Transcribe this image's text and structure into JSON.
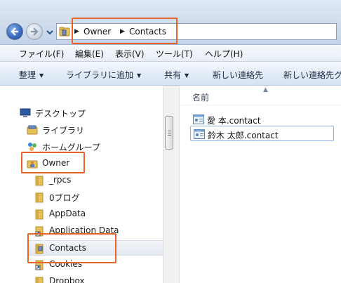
{
  "address": {
    "crumbs": [
      "Owner",
      "Contacts"
    ]
  },
  "menubar": {
    "items": [
      "ファイル(F)",
      "編集(E)",
      "表示(V)",
      "ツール(T)",
      "ヘルプ(H)"
    ]
  },
  "commandbar": {
    "items": [
      "整理",
      "ライブラリに追加",
      "共有",
      "新しい連絡先",
      "新しい連絡先グ"
    ]
  },
  "navpane": {
    "items": [
      {
        "label": "デスクトップ",
        "icon": "desktop-icon"
      },
      {
        "label": "ライブラリ",
        "icon": "library-icon"
      },
      {
        "label": "ホームグループ",
        "icon": "homegroup-icon"
      },
      {
        "label": "Owner",
        "icon": "user-folder-icon"
      },
      {
        "label": "_rpcs",
        "icon": "folder-icon"
      },
      {
        "label": "0ブログ",
        "icon": "folder-icon"
      },
      {
        "label": "AppData",
        "icon": "folder-icon"
      },
      {
        "label": "Application Data",
        "icon": "shortcut-folder-icon"
      },
      {
        "label": "Contacts",
        "icon": "contacts-folder-icon"
      },
      {
        "label": "Cookies",
        "icon": "shortcut-folder-icon"
      },
      {
        "label": "Dropbox",
        "icon": "folder-icon"
      }
    ]
  },
  "content": {
    "column_header": "名前",
    "files": [
      {
        "name": "愛 本.contact",
        "icon": "contact-card-icon"
      },
      {
        "name": "鈴木 太郎.contact",
        "icon": "contact-card-icon"
      }
    ]
  },
  "colors": {
    "highlight": "#e8632a",
    "selection": "#8fb4e2"
  }
}
